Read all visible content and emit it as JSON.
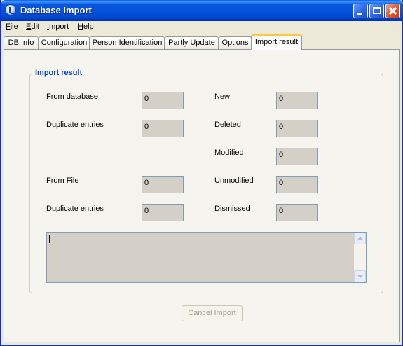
{
  "window": {
    "title": "Database Import",
    "icon": "app-import-icon"
  },
  "menu": [
    "File",
    "Edit",
    "Import",
    "Help"
  ],
  "tabs": [
    "DB Info",
    "Configuration",
    "Person Identification",
    "Partly Update",
    "Options",
    "Import result"
  ],
  "active_tab": "Import result",
  "group": {
    "title": "Import result",
    "left": [
      {
        "label": "From database",
        "value": "0"
      },
      {
        "label": "Duplicate entries",
        "value": "0"
      },
      {
        "label": "From File",
        "value": "0"
      },
      {
        "label": "Duplicate entries",
        "value": "0"
      }
    ],
    "right": [
      {
        "label": "New",
        "value": "0"
      },
      {
        "label": "Deleted",
        "value": "0"
      },
      {
        "label": "Modified",
        "value": "0"
      },
      {
        "label": "Unmodified",
        "value": "0"
      },
      {
        "label": "Dismissed",
        "value": "0"
      }
    ],
    "log_text": ""
  },
  "buttons": {
    "cancel_import": "Cancel Import"
  },
  "colors": {
    "title_bar": "#0352d8",
    "group_title": "#0046d5",
    "tab_highlight": "#ffc83c",
    "field_bg": "#d4d0c8"
  }
}
